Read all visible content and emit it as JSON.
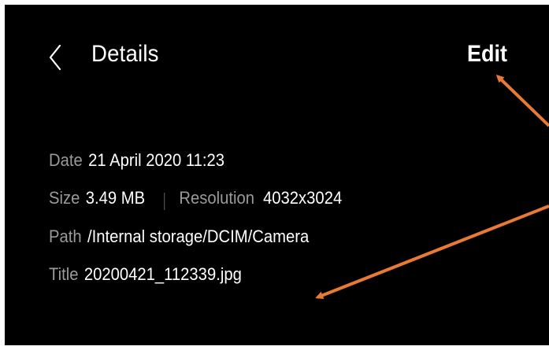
{
  "header": {
    "title": "Details",
    "edit_label": "Edit",
    "back_icon": "chevron-left-icon"
  },
  "details": {
    "date": {
      "label": "Date",
      "value": "21 April 2020 11:23"
    },
    "size": {
      "label": "Size",
      "value": "3.49 MB"
    },
    "resolution": {
      "label": "Resolution",
      "value": "4032x3024"
    },
    "path": {
      "label": "Path",
      "value": "/Internal storage/DCIM/Camera"
    },
    "title": {
      "label": "Title",
      "value": "20200421_112339.jpg"
    }
  },
  "colors": {
    "background": "#000000",
    "text_primary": "#ffffff",
    "text_label": "#9a9a9a",
    "annotation_arrow": "#e87a36"
  }
}
